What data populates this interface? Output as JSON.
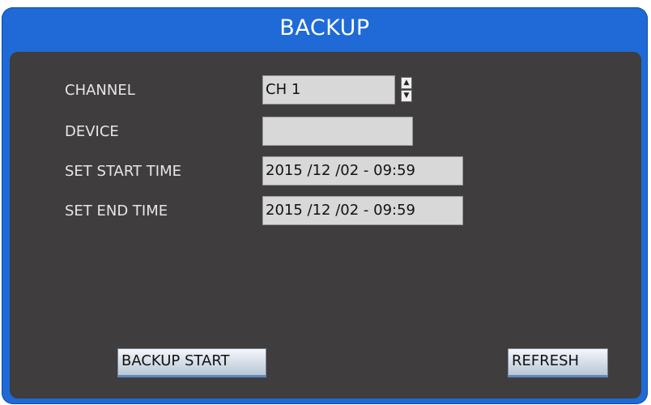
{
  "window": {
    "title": "BACKUP"
  },
  "form": {
    "channel": {
      "label": "CHANNEL",
      "value": "CH 1"
    },
    "device": {
      "label": "DEVICE",
      "value": ""
    },
    "start_time": {
      "label": "SET START TIME",
      "value": "2015 /12 /02 - 09:59"
    },
    "end_time": {
      "label": "SET END TIME",
      "value": "2015 /12 /02 - 09:59"
    }
  },
  "buttons": {
    "backup_start": "BACKUP START",
    "refresh": "REFRESH"
  },
  "icons": {
    "spin_up": "chevron-up-icon",
    "spin_down": "chevron-down-icon"
  },
  "colors": {
    "title_bar": "#1f6ad6",
    "panel": "#3f3d3d",
    "field": "#d8d8d8"
  }
}
